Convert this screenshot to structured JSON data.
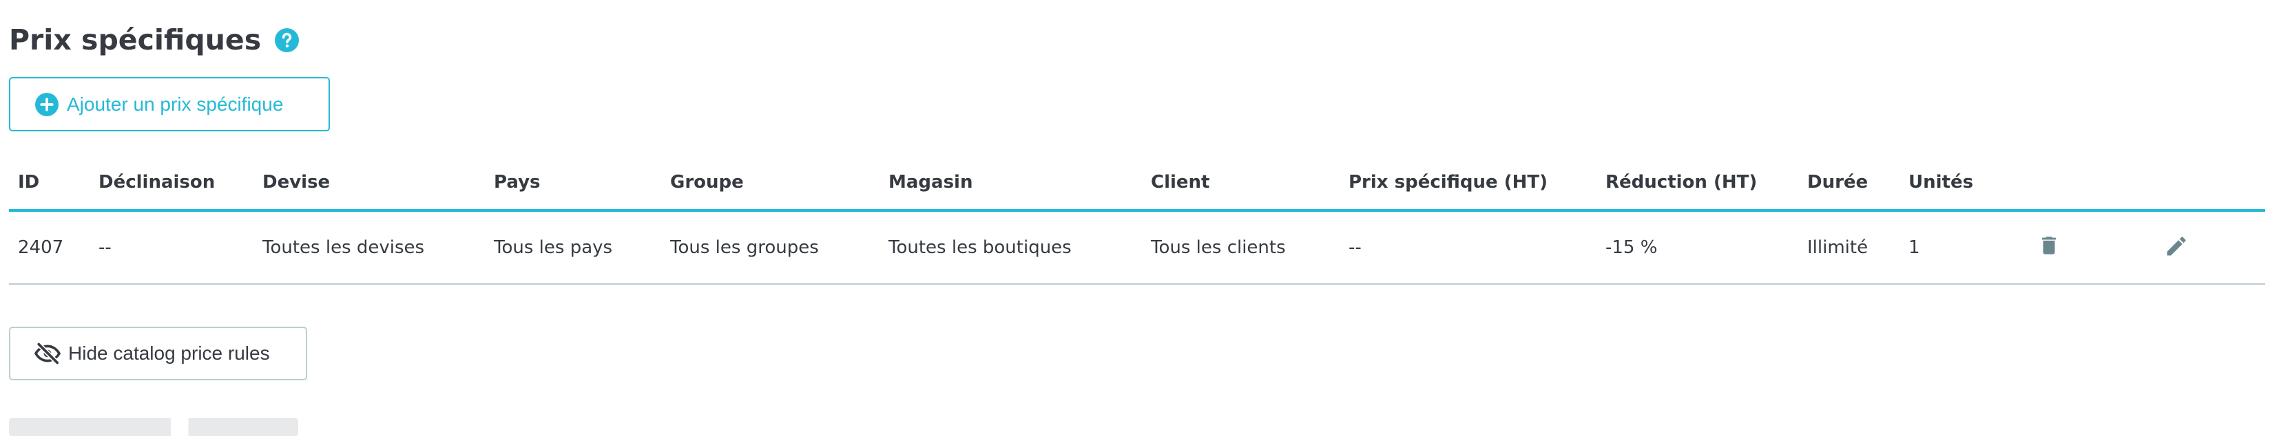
{
  "section": {
    "title": "Prix spécifiques",
    "help_icon": "question-circle-icon"
  },
  "buttons": {
    "add_label": "Ajouter un prix spécifique",
    "add_icon": "plus-circle-icon",
    "hide_label": "Hide catalog price rules",
    "hide_icon": "eye-slash-icon"
  },
  "table": {
    "columns": [
      "ID",
      "Déclinaison",
      "Devise",
      "Pays",
      "Groupe",
      "Magasin",
      "Client",
      "Prix spécifique (HT)",
      "Réduction (HT)",
      "Durée",
      "Unités",
      "",
      ""
    ],
    "rows": [
      {
        "id": "2407",
        "declinaison": "--",
        "devise": "Toutes les devises",
        "pays": "Tous les pays",
        "groupe": "Tous les groupes",
        "magasin": "Toutes les boutiques",
        "client": "Tous les clients",
        "prix": "--",
        "reduction": "-15 %",
        "duree": "Illimité",
        "unites": "1",
        "delete_icon": "trash-icon",
        "edit_icon": "pencil-icon"
      }
    ]
  },
  "colors": {
    "primary": "#25b9d7",
    "text": "#363a41",
    "border": "#bbcdd2",
    "icon": "#6c868e"
  }
}
